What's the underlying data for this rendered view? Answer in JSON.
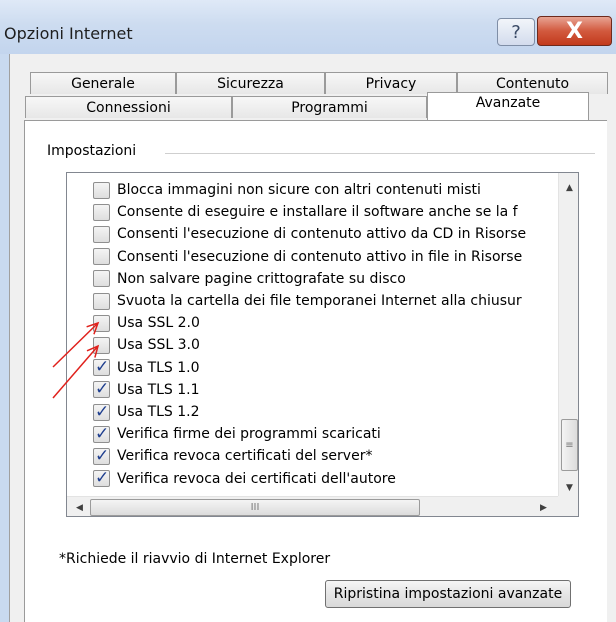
{
  "window": {
    "title": "Opzioni Internet",
    "help_icon": "question-mark-icon",
    "close_icon": "close-icon",
    "help_glyph": "?",
    "close_glyph": "X"
  },
  "tabs": {
    "row1": [
      "Generale",
      "Sicurezza",
      "Privacy",
      "Contenuto"
    ],
    "row2": [
      "Connessioni",
      "Programmi",
      "Avanzate"
    ],
    "active": "Avanzate"
  },
  "settings": {
    "group_label": "Impostazioni",
    "items": [
      {
        "label": "Blocca immagini non sicure con altri contenuti misti",
        "checked": false
      },
      {
        "label": "Consente di eseguire e installare il software anche se la f",
        "checked": false
      },
      {
        "label": "Consenti l'esecuzione di contenuto attivo da CD in Risorse",
        "checked": false
      },
      {
        "label": "Consenti l'esecuzione di contenuto attivo in file in Risorse",
        "checked": false
      },
      {
        "label": "Non salvare pagine crittografate su disco",
        "checked": false
      },
      {
        "label": "Svuota la cartella dei file temporanei Internet alla chiusur",
        "checked": false
      },
      {
        "label": "Usa SSL 2.0",
        "checked": false
      },
      {
        "label": "Usa SSL 3.0",
        "checked": false
      },
      {
        "label": "Usa TLS 1.0",
        "checked": true
      },
      {
        "label": "Usa TLS 1.1",
        "checked": true
      },
      {
        "label": "Usa TLS 1.2",
        "checked": true
      },
      {
        "label": "Verifica firme dei programmi scaricati",
        "checked": true
      },
      {
        "label": "Verifica revoca certificati del server*",
        "checked": true
      },
      {
        "label": "Verifica revoca dei certificati dell'autore",
        "checked": true
      }
    ],
    "scroll_up_glyph": "▲",
    "scroll_down_glyph": "▼",
    "scroll_left_glyph": "◀",
    "scroll_right_glyph": "▶",
    "vthumb_grip": "≡",
    "hthumb_grip": "III"
  },
  "footer": {
    "note": "*Richiede il riavvio di Internet Explorer",
    "reset_button": "Ripristina impostazioni avanzate"
  },
  "annotation": {
    "color": "#e0211c",
    "arrows_point_to": [
      "Usa SSL 2.0",
      "Usa SSL 3.0"
    ]
  }
}
